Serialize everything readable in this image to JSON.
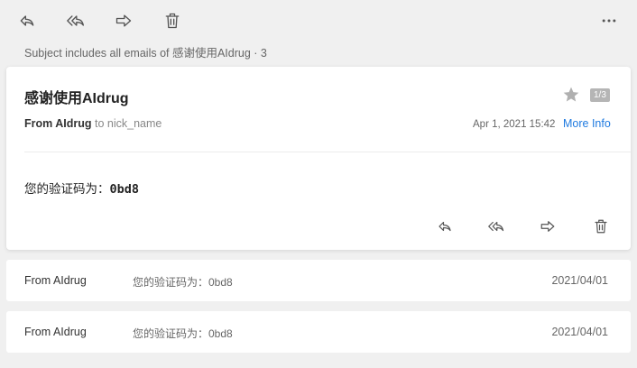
{
  "toolbar": {
    "icons": [
      "reply-icon",
      "reply-all-icon",
      "forward-icon",
      "trash-icon",
      "more-icon"
    ]
  },
  "thread": {
    "info": "Subject includes all emails of 感谢使用AIdrug · 3"
  },
  "message": {
    "subject": "感谢使用AIdrug",
    "page_badge": "1/3",
    "from_label": "From AIdrug",
    "to_label": "to nick_name",
    "date": "Apr 1, 2021  15:42",
    "more_info": "More Info",
    "body_prefix": "您的验证码为：",
    "body_code": "0bd8"
  },
  "list": [
    {
      "from": "From AIdrug",
      "snippet": "您的验证码为：0bd8",
      "date": "2021/04/01"
    },
    {
      "from": "From AIdrug",
      "snippet": "您的验证码为：0bd8",
      "date": "2021/04/01"
    }
  ],
  "colors": {
    "link": "#1f7ae0",
    "icon": "#555555",
    "star": "#b0b0b0"
  }
}
